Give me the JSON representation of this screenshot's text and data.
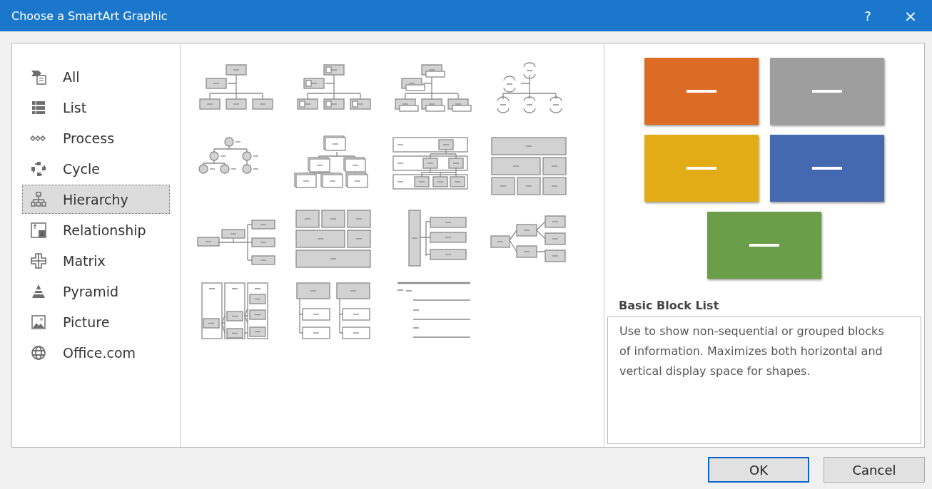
{
  "window": {
    "title": "Choose a SmartArt Graphic",
    "help_button": "?",
    "close_button": "×"
  },
  "categories": [
    {
      "label": "All",
      "kind": "all",
      "selected": false
    },
    {
      "label": "List",
      "kind": "list",
      "selected": false
    },
    {
      "label": "Process",
      "kind": "process",
      "selected": false
    },
    {
      "label": "Cycle",
      "kind": "cycle",
      "selected": false
    },
    {
      "label": "Hierarchy",
      "kind": "hierarchy",
      "selected": true
    },
    {
      "label": "Relationship",
      "kind": "relationship",
      "selected": false
    },
    {
      "label": "Matrix",
      "kind": "matrix",
      "selected": false
    },
    {
      "label": "Pyramid",
      "kind": "pyramid",
      "selected": false
    },
    {
      "label": "Picture",
      "kind": "picture",
      "selected": false
    },
    {
      "label": "Office.com",
      "kind": "web",
      "selected": false
    }
  ],
  "layouts": [
    {
      "kind": "org"
    },
    {
      "kind": "picture-org"
    },
    {
      "kind": "name-title-org"
    },
    {
      "kind": "half-circle-org"
    },
    {
      "kind": "circle-tree"
    },
    {
      "kind": "stacked-tree"
    },
    {
      "kind": "labeled-bands"
    },
    {
      "kind": "table"
    },
    {
      "kind": "horizontal-hierarchy"
    },
    {
      "kind": "architecture"
    },
    {
      "kind": "bracket-list"
    },
    {
      "kind": "horizontal-tree"
    },
    {
      "kind": "lined-columns"
    },
    {
      "kind": "grouped"
    },
    {
      "kind": "lined-list"
    }
  ],
  "preview": {
    "blocks": [
      {
        "color": "#dc6b26"
      },
      {
        "color": "#9e9e9e"
      },
      {
        "color": "#e2ac17"
      },
      {
        "color": "#4469b0"
      },
      {
        "color": "#6a9e48"
      }
    ],
    "title": "Basic Block List",
    "description": "Use to show non-sequential or grouped blocks of information. Maximizes both horizontal and vertical display space for shapes."
  },
  "buttons": [
    {
      "label": "OK",
      "kind": "default"
    },
    {
      "label": "Cancel",
      "kind": "normal"
    }
  ]
}
